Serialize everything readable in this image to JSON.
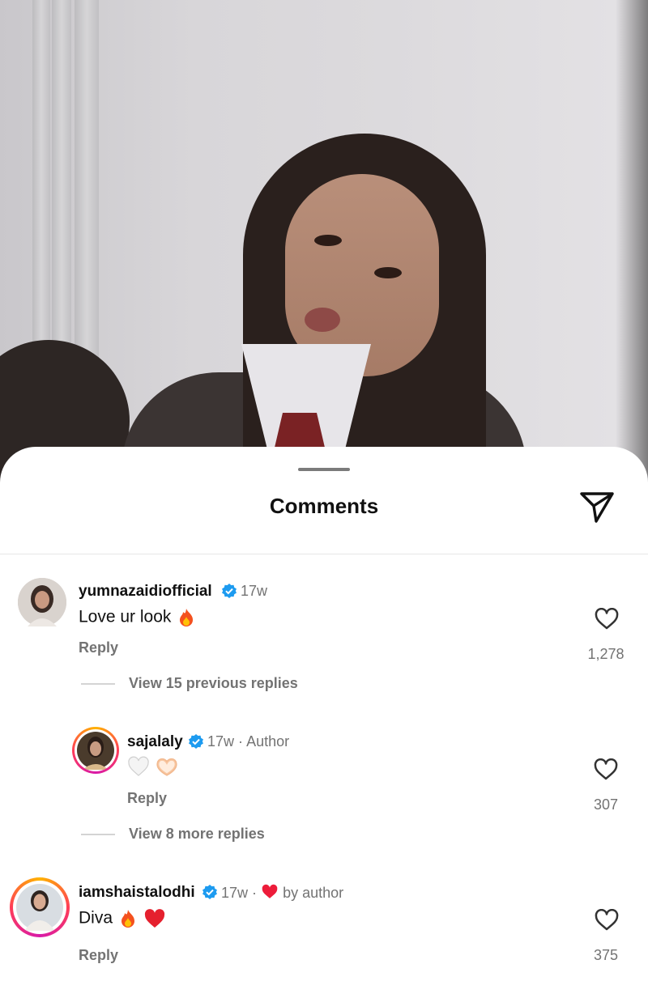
{
  "sheet": {
    "title": "Comments"
  },
  "comments": [
    {
      "username": "yumnazaidiofficial",
      "time": "17w",
      "text": "Love ur look",
      "reply_label": "Reply",
      "likes": "1,278",
      "view_replies": "View 15 previous replies"
    },
    {
      "username": "sajalaly",
      "time": "17w",
      "tag": "Author",
      "reply_label": "Reply",
      "likes": "307",
      "view_replies": "View 8 more replies",
      "is_reply": true
    },
    {
      "username": "iamshaistalodhi",
      "time": "17w",
      "liked_by": "by author",
      "text": "Diva",
      "reply_label": "Reply",
      "likes": "375"
    }
  ],
  "colors": {
    "verified": "#1d9bf0",
    "heart": "#ed1c3a",
    "muted": "#737373"
  },
  "icons": [
    "share-icon",
    "verified-icon",
    "heart-icon",
    "fire-emoji",
    "white-heart-emoji",
    "heart-hands-emoji",
    "red-heart-emoji"
  ]
}
